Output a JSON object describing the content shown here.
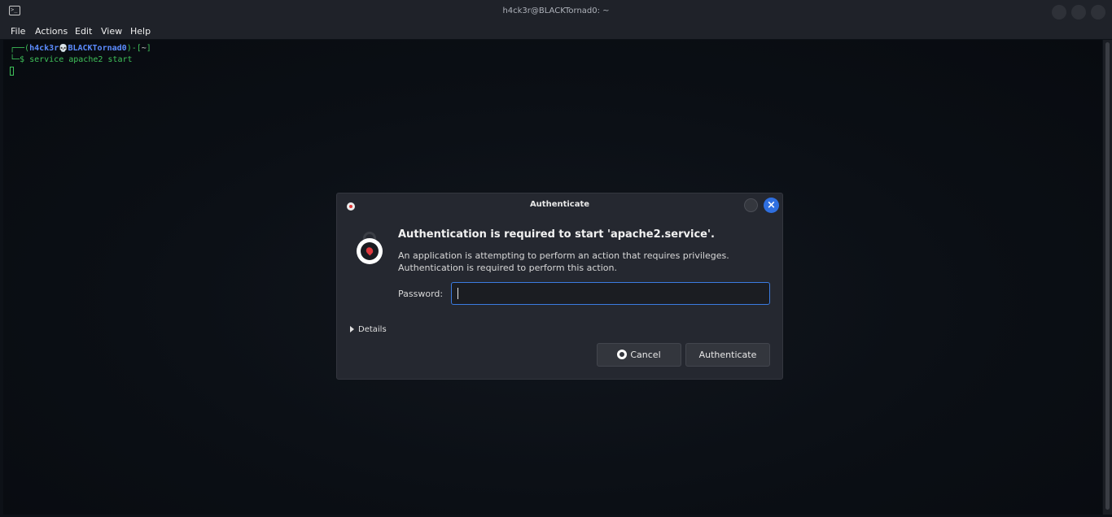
{
  "window": {
    "title": "h4ck3r@BLACKTornad0: ~",
    "app_icon_glyph": ">_"
  },
  "menu": {
    "items": [
      "File",
      "Actions",
      "Edit",
      "View",
      "Help"
    ]
  },
  "terminal": {
    "prompt_open": "┌──(",
    "user": "h4ck3r",
    "skull": "💀",
    "host": "BLACKTornad0",
    "prompt_mid": ")-[",
    "dir": "~",
    "prompt_close": "]",
    "prompt_symbol": "└─$",
    "command": " service apache2 start"
  },
  "dialog": {
    "title": "Authenticate",
    "close_glyph": "×",
    "heading": "Authentication is required to start 'apache2.service'.",
    "description": "An application is attempting to perform an action that requires privileges. Authentication is required to perform this action.",
    "password_label": "Password:",
    "password_value": "",
    "details_label": "Details",
    "cancel_label": "Cancel",
    "authenticate_label": "Authenticate"
  },
  "colors": {
    "accent": "#2f6fe0",
    "prompt_green": "#3fc15a",
    "prompt_blue": "#5c8cff",
    "lock_red": "#e0393e"
  }
}
